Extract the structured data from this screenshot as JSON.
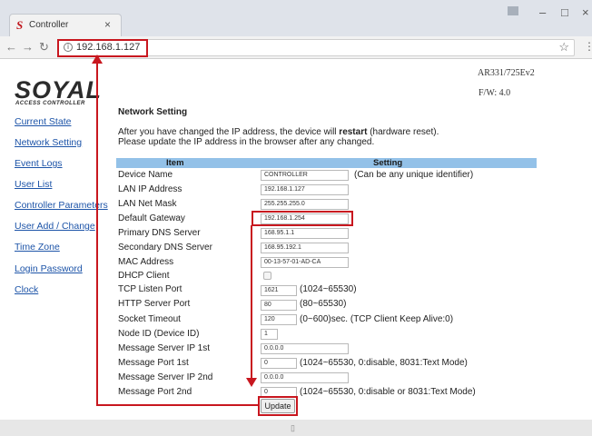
{
  "browser": {
    "tab_title": "Controller",
    "tab_logo": "S",
    "url": "192.168.1.127",
    "icons": [
      "back-icon",
      "forward-icon",
      "reload-icon",
      "info-icon",
      "star-icon",
      "menu-icon",
      "close-icon",
      "minimize-icon",
      "maximize-icon"
    ]
  },
  "header": {
    "logo": "SOYAL",
    "logo_sub": "ACCESS CONTROLLER",
    "model": "AR331/725Ev2",
    "firmware": "F/W: 4.0"
  },
  "sidebar": {
    "items": [
      {
        "label": "Current State"
      },
      {
        "label": "Network Setting"
      },
      {
        "label": "Event Logs"
      },
      {
        "label": "User List"
      },
      {
        "label": "Controller Parameters"
      },
      {
        "label": "User Add / Change"
      },
      {
        "label": "Time Zone"
      },
      {
        "label": "Login Password"
      },
      {
        "label": "Clock"
      }
    ]
  },
  "main": {
    "title": "Network Setting",
    "notice_line1_pre": "After you have changed the IP address, the device will ",
    "notice_bold": "restart",
    "notice_line1_post": " (hardware reset).",
    "notice_line2": "Please update the IP address in the browser after any changed.",
    "col_item": "Item",
    "col_setting": "Setting",
    "rows": [
      {
        "label": "Device Name",
        "value": "CONTROLLER",
        "note": "(Can be any unique identifier)"
      },
      {
        "label": "LAN IP Address",
        "value": "192.168.1.127",
        "note": ""
      },
      {
        "label": "LAN Net Mask",
        "value": "255.255.255.0",
        "note": ""
      },
      {
        "label": "Default Gateway",
        "value": "192.168.1.254",
        "note": ""
      },
      {
        "label": "Primary DNS Server",
        "value": "168.95.1.1",
        "note": ""
      },
      {
        "label": "Secondary DNS Server",
        "value": "168.95.192.1",
        "note": ""
      },
      {
        "label": "MAC Address",
        "value": "00-13-57-01-AD-CA",
        "note": ""
      },
      {
        "label": "DHCP Client",
        "value": "",
        "note": ""
      },
      {
        "label": "TCP Listen Port",
        "value": "1621",
        "note": "(1024~65530)"
      },
      {
        "label": "HTTP Server Port",
        "value": "80",
        "note": "(80~65530)"
      },
      {
        "label": "Socket Timeout",
        "value": "120",
        "note": "(0~600)sec. (TCP Client Keep Alive:0)"
      },
      {
        "label": "Node ID (Device ID)",
        "value": "1",
        "note": ""
      },
      {
        "label": "Message Server IP 1st",
        "value": "0.0.0.0",
        "note": ""
      },
      {
        "label": "Message Port 1st",
        "value": "0",
        "note": "(1024~65530, 0:disable,  8031:Text Mode)"
      },
      {
        "label": "Message Server IP 2nd",
        "value": "0.0.0.0",
        "note": ""
      },
      {
        "label": "Message Port 2nd",
        "value": "0",
        "note": "(1024~65530, 0:disable or 8031:Text Mode)"
      }
    ],
    "dhcp_checked": false,
    "update_label": "Update",
    "highlight_color": "#c8171f",
    "header_color": "#93c1e8",
    "link_color": "#1d54a8"
  }
}
